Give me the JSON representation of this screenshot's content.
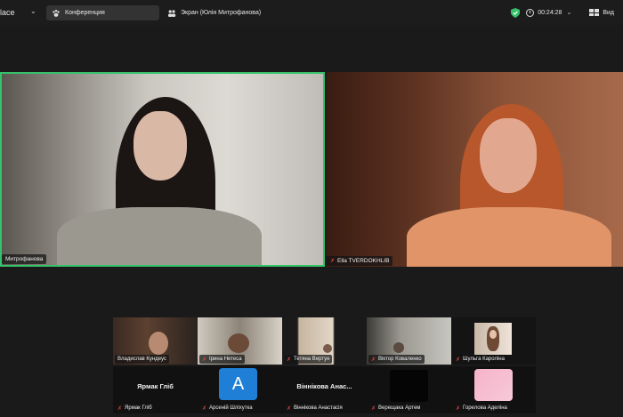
{
  "app": {
    "title": "lace"
  },
  "tabs": [
    {
      "label": "Конференция",
      "icon": "paw-icon",
      "active": true
    },
    {
      "label": "Экран (Юлія Митрофанова)",
      "icon": "people-icon",
      "active": false
    }
  ],
  "status": {
    "timer": "00:24:28",
    "view_label": "Вид",
    "secure_color": "#35c26a"
  },
  "speakers": [
    {
      "name": "Митрофанова",
      "muted": false,
      "active_border": "#35c26a"
    },
    {
      "name": "Ella TVERDOKHLIB",
      "muted": true
    }
  ],
  "gallery": [
    {
      "name": "Владислав Кундеус",
      "muted": false,
      "kind": "video"
    },
    {
      "name": "Ірина Нетеса",
      "muted": true,
      "kind": "video"
    },
    {
      "name": "Тетяна Вертун",
      "muted": true,
      "kind": "video"
    },
    {
      "name": "Віктор Коваленко",
      "muted": true,
      "kind": "video"
    },
    {
      "name": "Шульга Кароліна",
      "muted": true,
      "kind": "video"
    },
    {
      "name": "Ярмак Гліб",
      "display": "Ярмак Гліб",
      "muted": true,
      "kind": "placeholder"
    },
    {
      "name": "Арсеній Шліхутка",
      "avatar_letter": "A",
      "avatar_color": "#1f7fd6",
      "muted": true,
      "kind": "avatar"
    },
    {
      "name": "Віннікова Анастасія",
      "display": "Віннікова Анас...",
      "muted": true,
      "kind": "placeholder"
    },
    {
      "name": "Верещака Артем",
      "muted": true,
      "kind": "dark"
    },
    {
      "name": "Горелова Аделіна",
      "muted": true,
      "kind": "pink"
    }
  ]
}
